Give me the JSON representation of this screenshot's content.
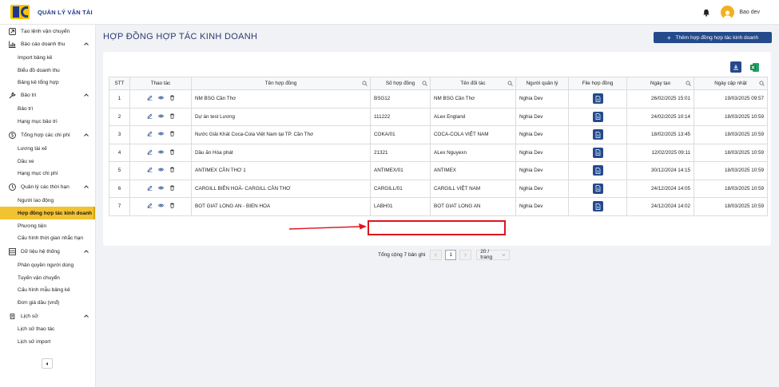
{
  "app": {
    "title": "QUẢN LÝ VẬN TẢI",
    "user_name": "Bao dev"
  },
  "sidebar": {
    "items": [
      {
        "type": "group",
        "label": "Tạo lệnh vận chuyển",
        "icon": "dispatch-icon"
      },
      {
        "type": "group",
        "label": "Báo cáo doanh thu",
        "icon": "chart-icon",
        "expanded": true
      },
      {
        "type": "item",
        "label": "Import bảng kê"
      },
      {
        "type": "item",
        "label": "Biểu đồ doanh thu"
      },
      {
        "type": "item",
        "label": "Bảng kê tổng hợp"
      },
      {
        "type": "group",
        "label": "Bảo trì",
        "icon": "wrench-icon",
        "expanded": true
      },
      {
        "type": "item",
        "label": "Bảo trì"
      },
      {
        "type": "item",
        "label": "Hạng mục bảo trì"
      },
      {
        "type": "group",
        "label": "Tổng hợp các chi phí",
        "icon": "dollar-icon",
        "expanded": true
      },
      {
        "type": "item",
        "label": "Lương tài xế"
      },
      {
        "type": "item",
        "label": "Dầu xe"
      },
      {
        "type": "item",
        "label": "Hạng mục chi phí"
      },
      {
        "type": "group",
        "label": "Quản lý các thời hạn",
        "icon": "clock-icon",
        "expanded": true
      },
      {
        "type": "item",
        "label": "Người lao động"
      },
      {
        "type": "item",
        "label": "Hợp đồng hợp tác kinh doanh",
        "active": true
      },
      {
        "type": "item",
        "label": "Phương tiện"
      },
      {
        "type": "item",
        "label": "Cấu hình thời gian nhắc hạn"
      },
      {
        "type": "group",
        "label": "Dữ liệu hệ thống",
        "icon": "database-icon",
        "expanded": true
      },
      {
        "type": "item",
        "label": "Phân quyền người dùng"
      },
      {
        "type": "item",
        "label": "Tuyến vận chuyển"
      },
      {
        "type": "item",
        "label": "Cấu hình mẫu bảng kê"
      },
      {
        "type": "item",
        "label": "Đơn giá dầu (vnđ)"
      },
      {
        "type": "group",
        "label": "Lịch sử",
        "icon": "history-icon",
        "expanded": true
      },
      {
        "type": "item",
        "label": "Lịch sử thao tác"
      },
      {
        "type": "item",
        "label": "Lịch sử import"
      }
    ]
  },
  "main": {
    "page_title": "HỢP ĐỒNG HỢP TÁC KINH DOANH",
    "add_button": "Thêm hợp đồng hợp tác kinh doanh",
    "table": {
      "columns": [
        "STT",
        "Thao tác",
        "Tên hợp đồng",
        "Số hợp đồng",
        "Tên đối tác",
        "Người quản lý",
        "File hợp đồng",
        "Ngày tạo",
        "Ngày cập nhật"
      ],
      "rows": [
        [
          "1",
          "",
          "NM BSG Cần Thơ",
          "BSG12",
          "NM BSG Cần Thơ",
          "Nghia Dev",
          "",
          "26/02/2025 15:01",
          "19/03/2025 09:57"
        ],
        [
          "2",
          "",
          "Dự án test Lương",
          "111222",
          "ALex England",
          "Nghia Dev",
          "",
          "24/02/2025 10:14",
          "18/03/2025 10:59"
        ],
        [
          "3",
          "",
          "Nước Giải Khát Coca-Cola Việt Nam tại TP. Cần Thơ",
          "COKA/01",
          "COCA-COLA VIỆT NAM",
          "Nghia Dev",
          "",
          "18/02/2025 13:45",
          "18/03/2025 10:59"
        ],
        [
          "4",
          "",
          "Dầu ăn Hòa phát",
          "21321",
          "ALex Nguyexn",
          "Nghia Dev",
          "",
          "12/02/2025 09:11",
          "18/03/2025 10:59"
        ],
        [
          "5",
          "",
          "ANTIMEX CẦN THƠ 1",
          "ANTIMEX/01",
          "ANTIMEX",
          "Nghia Dev",
          "",
          "30/12/2024 14:15",
          "18/03/2025 10:59"
        ],
        [
          "6",
          "",
          "CARGILL BIÊN HOÀ- CARGILL CẦN THƠ",
          "CARGILL/01",
          "CARGILL VIỆT NAM",
          "Nghia Dev",
          "",
          "24/12/2024 14:05",
          "18/03/2025 10:59"
        ],
        [
          "7",
          "",
          "BOT GIAT LONG AN - BIEN HOA",
          "LABH01",
          "BOT GIAT LONG AN",
          "Nghia Dev",
          "",
          "24/12/2024 14:02",
          "18/03/2025 10:59"
        ]
      ]
    },
    "pagination": {
      "total_text": "Tổng cộng 7 bản ghi",
      "current_page": "1",
      "page_size": "20 / trang"
    }
  },
  "colors": {
    "primary": "#244a8c",
    "active": "#f2c230",
    "highlight": "#e0141e"
  }
}
